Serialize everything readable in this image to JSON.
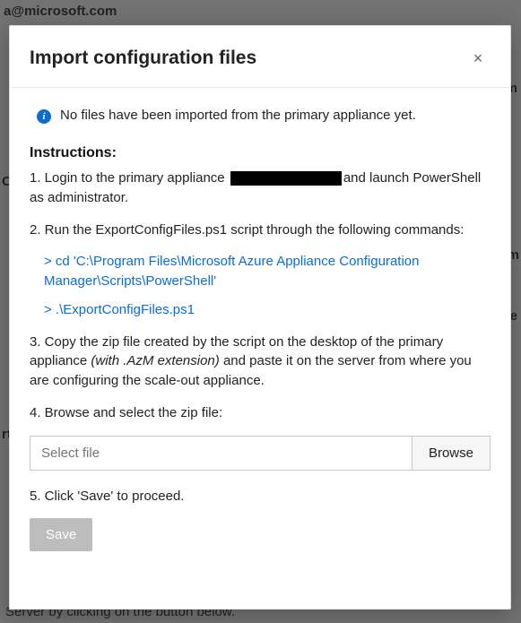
{
  "background": {
    "text_top": "a@microsoft.com",
    "text_right1": "om",
    "text_right2": "m",
    "text_right3": "ne",
    "text_left1": "O",
    "text_left2": "rt",
    "text_bottom": "Server by clicking on the button below."
  },
  "modal": {
    "title": "Import configuration files",
    "close_label": "×"
  },
  "banner": {
    "icon_glyph": "i",
    "text": "No files have been imported from the primary appliance yet."
  },
  "instructions": {
    "heading": "Instructions:",
    "step1_a": "1. Login to the primary appliance ",
    "step1_b": "and launch PowerShell as administrator.",
    "step2": "2. Run the ExportConfigFiles.ps1 script through the following commands:",
    "cmd1": "> cd 'C:\\Program Files\\Microsoft Azure Appliance Configuration Manager\\Scripts\\PowerShell'",
    "cmd2": "> .\\ExportConfigFiles.ps1",
    "step3_a": "3. Copy the zip file created by the script on the desktop of the primary appliance ",
    "step3_b": "(with .AzM extension)",
    "step3_c": " and paste it on the server from where you are configuring the scale-out appliance.",
    "step4": "4. Browse and select the zip file:",
    "step5": "5. Click 'Save' to proceed."
  },
  "file_picker": {
    "placeholder": "Select file",
    "browse_label": "Browse"
  },
  "actions": {
    "save_label": "Save"
  }
}
